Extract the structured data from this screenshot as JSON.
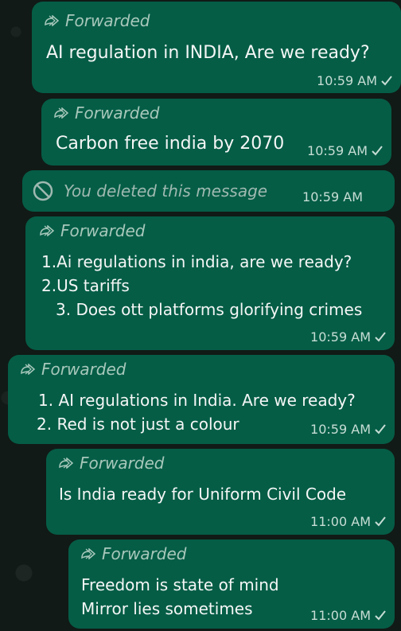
{
  "messages": [
    {
      "forwarded_label": "Forwarded",
      "lines": [
        "AI regulation in INDIA, Are we ready?"
      ],
      "time": "10:59 AM"
    },
    {
      "forwarded_label": "Forwarded",
      "lines": [
        "Carbon free india by 2070"
      ],
      "time": "10:59 AM"
    },
    {
      "deleted_label": "You deleted this message",
      "time": "10:59 AM"
    },
    {
      "forwarded_label": "Forwarded",
      "lines": [
        "1.Ai regulations in india, are we ready?",
        "2.US tariffs",
        "3. Does ott platforms glorifying crimes"
      ],
      "time": "10:59 AM"
    },
    {
      "forwarded_label": "Forwarded",
      "lines": [
        "1. AI regulations in India. Are we ready?",
        "2. Red is not just a colour"
      ],
      "time": "10:59 AM"
    },
    {
      "forwarded_label": "Forwarded",
      "lines": [
        "Is India ready for Uniform Civil Code"
      ],
      "time": "11:00 AM"
    },
    {
      "forwarded_label": "Forwarded",
      "lines": [
        "Freedom is state of mind",
        "Mirror lies sometimes"
      ],
      "time": "11:00 AM"
    }
  ],
  "icons": {
    "forwarded": "forward-arrow-icon",
    "tick": "check-icon",
    "deleted": "blocked-icon"
  }
}
